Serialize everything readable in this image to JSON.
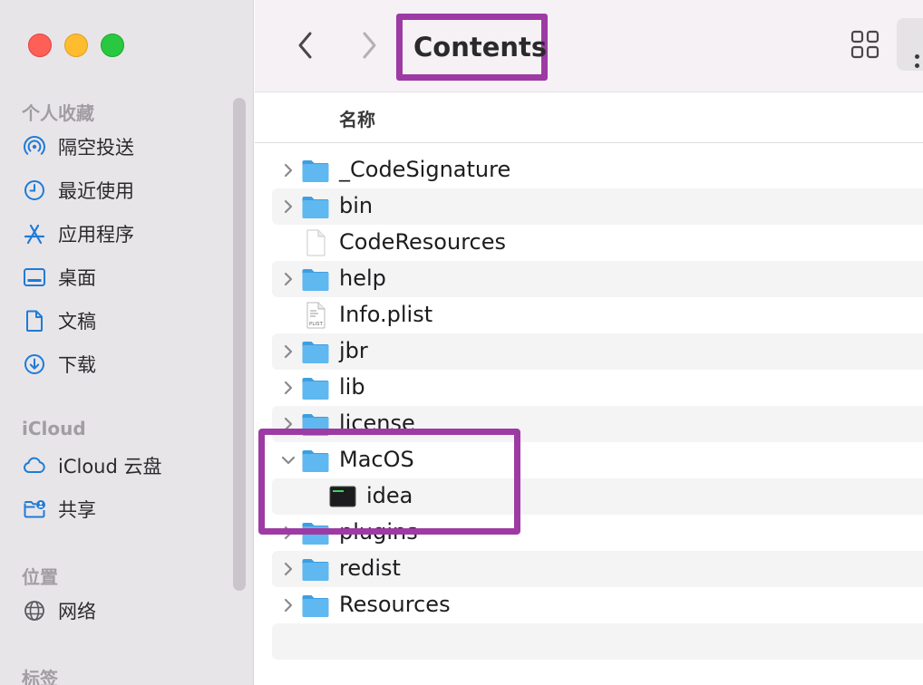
{
  "window": {
    "title": "Contents"
  },
  "sidebar": {
    "sections": {
      "favorites": "个人收藏",
      "icloud": "iCloud",
      "locations": "位置",
      "tags": "标签"
    },
    "items": [
      {
        "label": "隔空投送",
        "icon": "airdrop-icon"
      },
      {
        "label": "最近使用",
        "icon": "clock-icon"
      },
      {
        "label": "应用程序",
        "icon": "applications-icon"
      },
      {
        "label": "桌面",
        "icon": "desktop-icon"
      },
      {
        "label": "文稿",
        "icon": "document-icon"
      },
      {
        "label": "下载",
        "icon": "download-icon"
      },
      {
        "label": "iCloud 云盘",
        "icon": "cloud-icon"
      },
      {
        "label": "共享",
        "icon": "shared-folder-icon"
      },
      {
        "label": "网络",
        "icon": "globe-icon"
      }
    ]
  },
  "toolbar": {
    "back_icon": "chevron-left-icon",
    "forward_icon": "chevron-right-icon",
    "view_icon": "grid-view-icon",
    "more_icon": "more-icon"
  },
  "list": {
    "column_header": "名称",
    "rows": [
      {
        "name": "_CodeSignature",
        "type": "folder",
        "expandable": true,
        "expanded": false
      },
      {
        "name": "bin",
        "type": "folder",
        "expandable": true,
        "expanded": false
      },
      {
        "name": "CodeResources",
        "type": "file",
        "expandable": false
      },
      {
        "name": "help",
        "type": "folder",
        "expandable": true,
        "expanded": false
      },
      {
        "name": "Info.plist",
        "type": "plist",
        "expandable": false,
        "icon_text": "PLIST"
      },
      {
        "name": "jbr",
        "type": "folder",
        "expandable": true,
        "expanded": false
      },
      {
        "name": "lib",
        "type": "folder",
        "expandable": true,
        "expanded": false
      },
      {
        "name": "license",
        "type": "folder",
        "expandable": true,
        "expanded": false
      },
      {
        "name": "MacOS",
        "type": "folder",
        "expandable": true,
        "expanded": true
      },
      {
        "name": "idea",
        "type": "executable",
        "expandable": false,
        "indent": 1
      },
      {
        "name": "plugins",
        "type": "folder",
        "expandable": true,
        "expanded": false
      },
      {
        "name": "redist",
        "type": "folder",
        "expandable": true,
        "expanded": false
      },
      {
        "name": "Resources",
        "type": "folder",
        "expandable": true,
        "expanded": false
      }
    ]
  },
  "colors": {
    "highlight": "#9d3aa4",
    "accent": "#1f7bd6",
    "folder": "#5fb8ef"
  }
}
